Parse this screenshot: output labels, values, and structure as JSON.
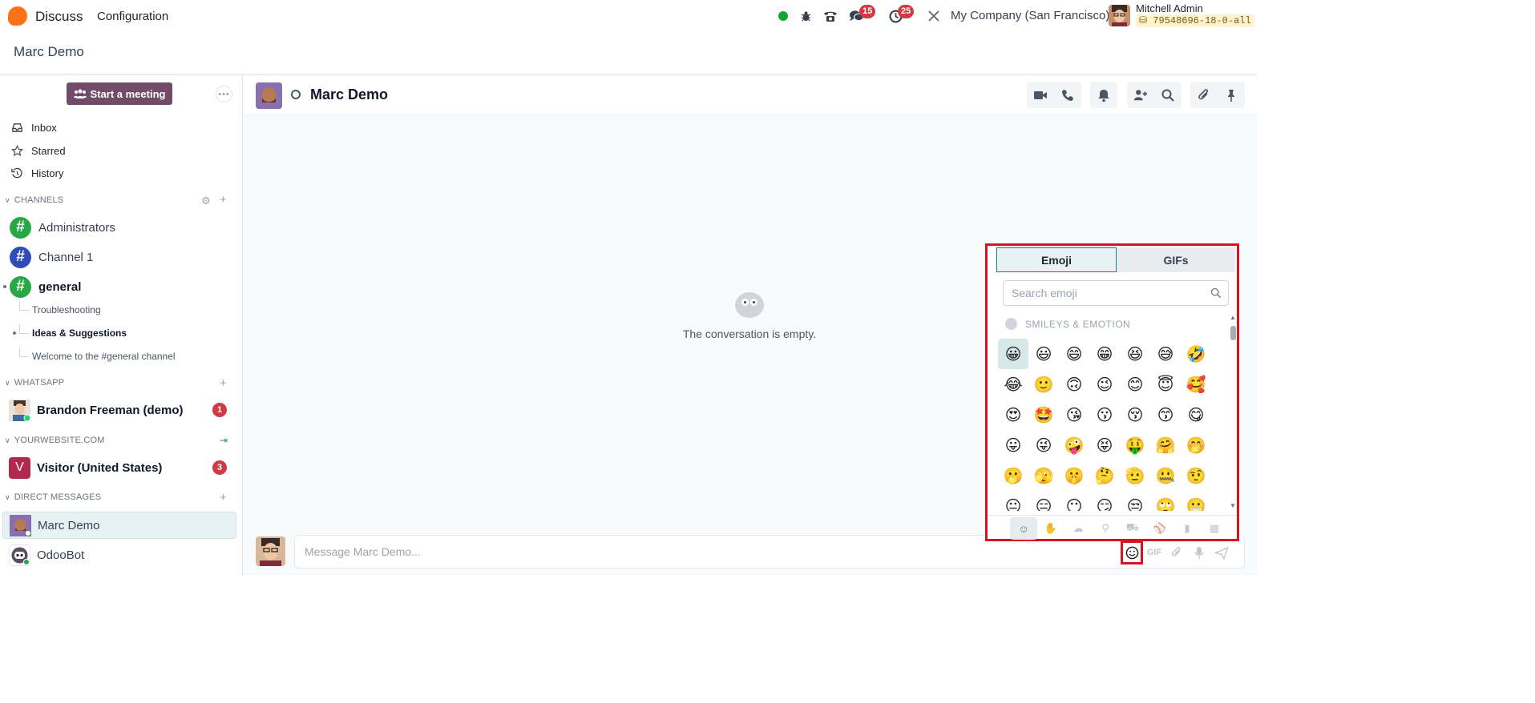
{
  "topbar": {
    "app_name": "Discuss",
    "menu_config": "Configuration",
    "messages_badge": "15",
    "activities_badge": "25",
    "company": "My Company (San Francisco)",
    "user_name": "Mitchell Admin",
    "db_name": "79548696-18-0-all"
  },
  "breadcrumb": {
    "title": "Marc Demo"
  },
  "sidebar": {
    "start_meeting": "Start a meeting",
    "nav": {
      "inbox": "Inbox",
      "starred": "Starred",
      "history": "History"
    },
    "sections": {
      "channels": "CHANNELS",
      "whatsapp": "WHATSAPP",
      "website": "YOURWEBSITE.COM",
      "direct": "DIRECT MESSAGES"
    },
    "channels": [
      {
        "name": "Administrators",
        "color": "#28a745"
      },
      {
        "name": "Channel 1",
        "color": "#2e4db8"
      },
      {
        "name": "general",
        "color": "#28a745"
      }
    ],
    "sub_channels": [
      "Troubleshooting",
      "Ideas & Suggestions",
      "Welcome to the #general channel"
    ],
    "whatsapp_contact": {
      "name": "Brandon Freeman (demo)",
      "count": "1"
    },
    "visitor": {
      "initial": "V",
      "name": "Visitor (United States)",
      "count": "3"
    },
    "direct_messages": [
      "Marc Demo",
      "OdooBot"
    ]
  },
  "thread": {
    "name": "Marc Demo",
    "empty_text": "The conversation is empty."
  },
  "composer": {
    "placeholder": "Message Marc Demo...",
    "gif_label": "GIF"
  },
  "emoji_picker": {
    "tab_emoji": "Emoji",
    "tab_gifs": "GIFs",
    "search_placeholder": "Search emoji",
    "category": "SMILEYS & EMOTION",
    "emojis": [
      "😀",
      "😃",
      "😄",
      "😁",
      "😆",
      "😅",
      "🤣",
      "😂",
      "🙂",
      "🙃",
      "😉",
      "😊",
      "😇",
      "🥰",
      "😍",
      "🤩",
      "😘",
      "😗",
      "😚",
      "😙",
      "😋",
      "😛",
      "😜",
      "🤪",
      "😝",
      "🤑",
      "🤗",
      "🤭",
      "🫢",
      "🫣",
      "🤫",
      "🤔",
      "🫡",
      "🤐",
      "🤨",
      "😐",
      "😑",
      "😶",
      "😏",
      "😒",
      "🙄",
      "😬"
    ]
  },
  "colors": {
    "brand": "#714b67",
    "badge": "#d23a43",
    "highlight": "#d9121f"
  }
}
